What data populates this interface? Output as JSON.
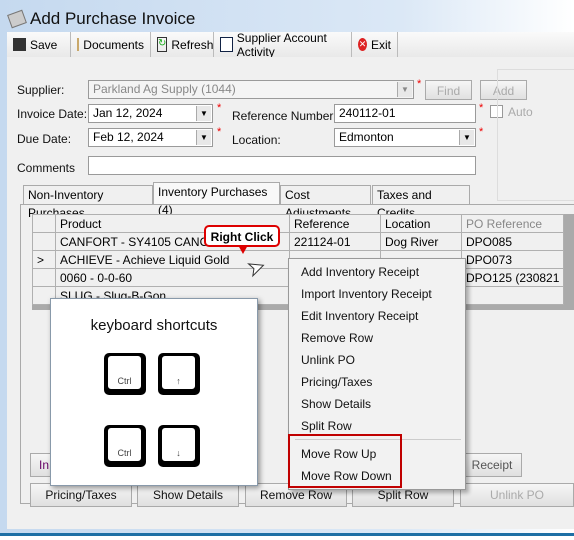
{
  "window": {
    "title": "Add Purchase Invoice"
  },
  "toolbar": {
    "save": "Save",
    "documents": "Documents",
    "refresh": "Refresh",
    "supplier_activity": "Supplier Account Activity",
    "exit": "Exit"
  },
  "form": {
    "supplier_label": "Supplier:",
    "supplier_value": "Parkland Ag Supply (1044)",
    "find": "Find",
    "add": "Add",
    "invoice_date_label": "Invoice Date:",
    "invoice_date": "Jan  12, 2024",
    "reference_label": "Reference Number:",
    "reference": "240112-01",
    "auto": "Auto",
    "due_date_label": "Due Date:",
    "due_date": "Feb  12, 2024",
    "location_label": "Location:",
    "location": "Edmonton",
    "comments_label": "Comments",
    "comments": "",
    "required": "*"
  },
  "tabs": [
    {
      "label": "Non-Inventory Purchases"
    },
    {
      "label": "Inventory Purchases (4)"
    },
    {
      "label": "Cost Adjustments"
    },
    {
      "label": "Taxes and Credits"
    }
  ],
  "grid": {
    "columns": [
      "Product",
      "Reference",
      "Location",
      "PO Reference"
    ],
    "rows": [
      {
        "marker": "",
        "product": "CANFORT - SY4105 CANOLA",
        "reference": "221124-01",
        "location": "Dog River",
        "po": "DPO085"
      },
      {
        "marker": ">",
        "product": "ACHIEVE - Achieve Liquid Gold",
        "reference": "",
        "location": "",
        "po": "DPO073"
      },
      {
        "marker": "",
        "product": "0060 - 0-0-60",
        "reference": "",
        "location": "",
        "po": "DPO125 (230821"
      },
      {
        "marker": "",
        "product": "SLUG - Slug-B-Gon",
        "reference": "",
        "location": "",
        "po": ""
      }
    ]
  },
  "callout": "Right Click",
  "context_menu": [
    "Add Inventory Receipt",
    "Import Inventory Receipt",
    "Edit Inventory Receipt",
    "Remove Row",
    "Unlink PO",
    "Pricing/Taxes",
    "Show Details",
    "Split Row",
    "Move Row Up",
    "Move Row Down"
  ],
  "shortcuts": {
    "title": "keyboard shortcuts",
    "ctrl": "Ctrl",
    "up": "↑",
    "down": "↓"
  },
  "buttons": {
    "import": "In",
    "receipt": "Receipt",
    "pricing": "Pricing/Taxes",
    "details": "Show Details",
    "remove": "Remove Row",
    "split": "Split Row",
    "unlink": "Unlink PO"
  },
  "colors": {
    "highlight": "#c00000",
    "required": "#e00000"
  }
}
